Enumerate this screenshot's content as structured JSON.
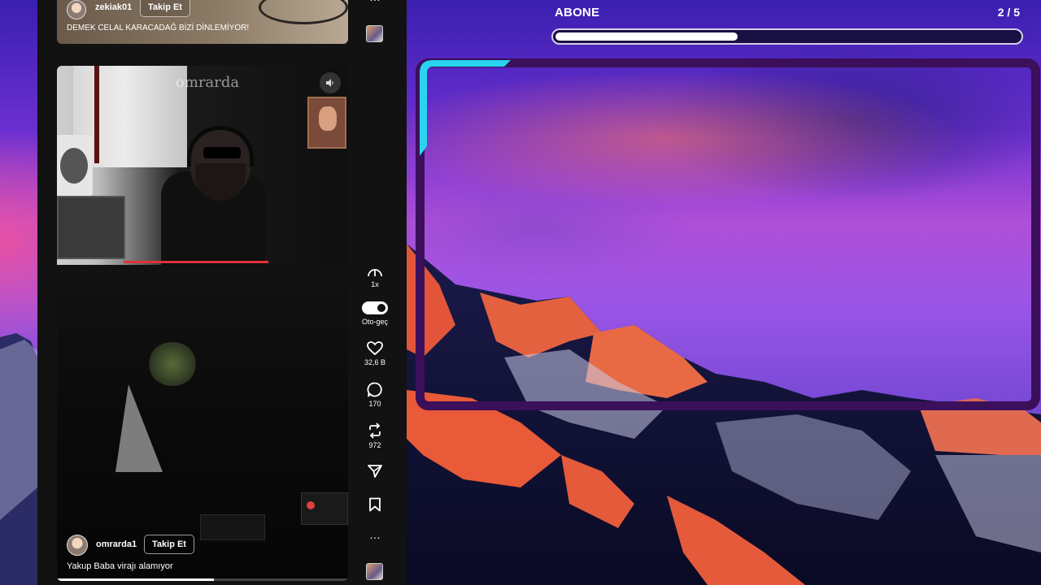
{
  "top_post": {
    "username": "zekiak01",
    "follow_label": "Takip Et",
    "caption": "DEMEK CELAL KARACADAĞ BİZİ DİNLEMİYOR!"
  },
  "video": {
    "watermark": "omrarda",
    "username": "omrarda1",
    "follow_label": "Takip Et",
    "caption": "Yakup Baba virajı alamıyor",
    "playback_progress": 0.54
  },
  "rail": {
    "more_top": "…",
    "speed_label": "1x",
    "autoplay_label": "Oto-geç",
    "likes": "32,6 B",
    "comments": "170",
    "reposts": "972",
    "more_bottom": "…"
  },
  "goal": {
    "title": "ABONE",
    "count": "2 / 5",
    "progress": 0.4
  },
  "colors": {
    "frame": "#3b0f5a",
    "frame_accent": "#2ad4f0",
    "live_bar": "#e0303a"
  }
}
